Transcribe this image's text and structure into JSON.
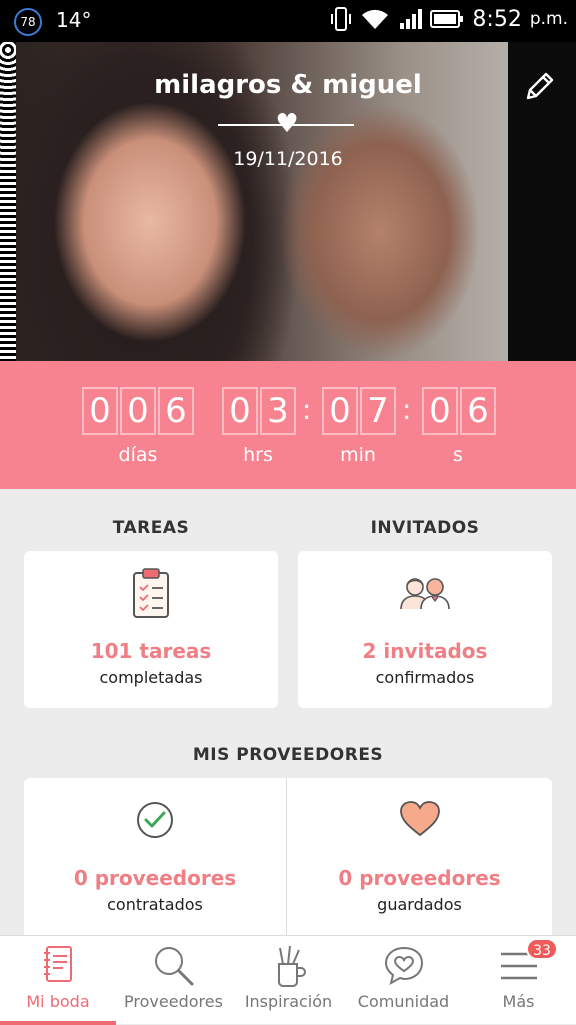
{
  "status_bar": {
    "notification_count": "78",
    "temperature": "14°",
    "time": "8:52",
    "ampm": "p.m.",
    "icons": [
      "vibrate-icon",
      "wifi-icon",
      "signal-icon",
      "battery-icon"
    ]
  },
  "hero": {
    "couple_names": "milagros & miguel",
    "wedding_date": "19/11/2016",
    "edit_icon": "pencil-icon"
  },
  "countdown": {
    "days": [
      "0",
      "0",
      "6"
    ],
    "hours": [
      "0",
      "3"
    ],
    "minutes": [
      "0",
      "7"
    ],
    "seconds": [
      "0",
      "6"
    ],
    "labels": {
      "days": "días",
      "hours": "hrs",
      "minutes": "min",
      "seconds": "s"
    }
  },
  "sections": {
    "tasks_title": "TAREAS",
    "guests_title": "INVITADOS",
    "providers_title": "MIS PROVEEDORES"
  },
  "cards": {
    "tasks": {
      "main": "101 tareas",
      "sub": "completadas",
      "icon": "clipboard-checklist-icon"
    },
    "guests": {
      "main": "2 invitados",
      "sub": "confirmados",
      "icon": "guests-people-icon"
    },
    "hired": {
      "main": "0 proveedores",
      "sub": "contratados",
      "icon": "check-circle-icon"
    },
    "saved": {
      "main": "0 proveedores",
      "sub": "guardados",
      "icon": "heart-icon"
    }
  },
  "tabs": [
    {
      "label": "Mi boda",
      "icon": "notebook-icon",
      "active": true
    },
    {
      "label": "Proveedores",
      "icon": "search-icon",
      "active": false
    },
    {
      "label": "Inspiración",
      "icon": "brush-cup-icon",
      "active": false
    },
    {
      "label": "Comunidad",
      "icon": "chat-heart-icon",
      "active": false
    },
    {
      "label": "Más",
      "icon": "hamburger-menu-icon",
      "active": false
    }
  ],
  "more_badge": "33",
  "colors": {
    "accent": "#f6838f",
    "tab_active": "#ef6b73",
    "value_text": "#ef7f84"
  }
}
